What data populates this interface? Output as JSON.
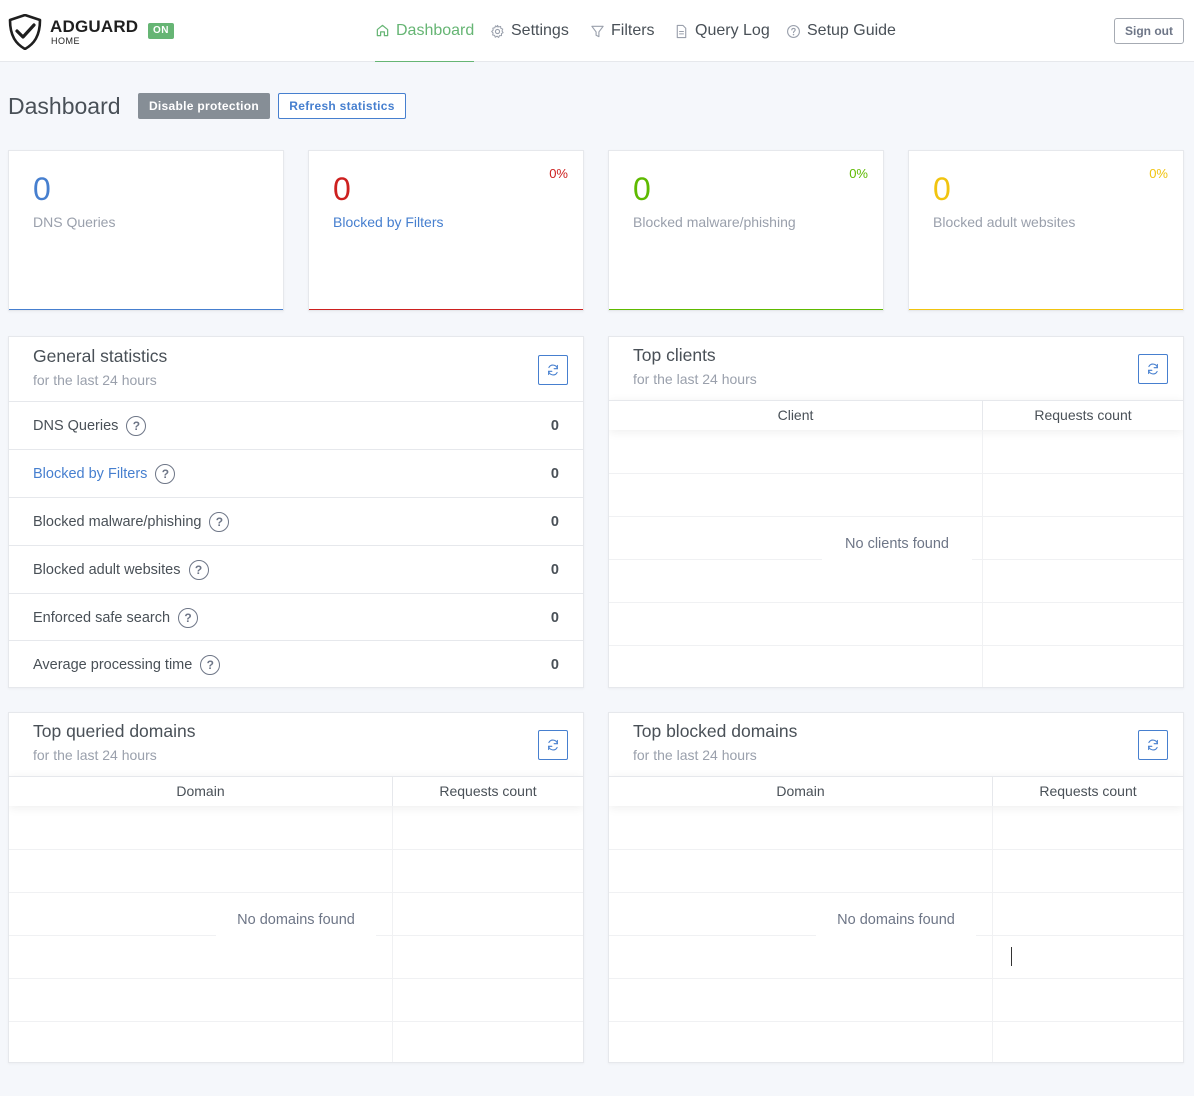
{
  "header": {
    "brand": "ADGUARD",
    "brand_sub": "HOME",
    "status_badge": "ON",
    "nav": [
      {
        "label": "Dashboard",
        "icon": "home-icon",
        "active": true
      },
      {
        "label": "Settings",
        "icon": "gear-icon",
        "active": false
      },
      {
        "label": "Filters",
        "icon": "filter-icon",
        "active": false
      },
      {
        "label": "Query Log",
        "icon": "document-icon",
        "active": false
      },
      {
        "label": "Setup Guide",
        "icon": "help-circle-icon",
        "active": false
      }
    ],
    "sign_out": "Sign out"
  },
  "page": {
    "title": "Dashboard",
    "disable_button": "Disable protection",
    "refresh_button": "Refresh statistics"
  },
  "counters": [
    {
      "value": "0",
      "label": "DNS Queries",
      "percent": "",
      "color": "#467fcf"
    },
    {
      "value": "0",
      "label": "Blocked by Filters",
      "percent": "0%",
      "color": "#cd201f"
    },
    {
      "value": "0",
      "label": "Blocked malware/phishing",
      "percent": "0%",
      "color": "#5eba00"
    },
    {
      "value": "0",
      "label": "Blocked adult websites",
      "percent": "0%",
      "color": "#f1c40f"
    }
  ],
  "general_stats": {
    "title": "General statistics",
    "subtitle": "for the last 24 hours",
    "rows": [
      {
        "label": "DNS Queries",
        "value": "0"
      },
      {
        "label": "Blocked by Filters",
        "value": "0"
      },
      {
        "label": "Blocked malware/phishing",
        "value": "0"
      },
      {
        "label": "Blocked adult websites",
        "value": "0"
      },
      {
        "label": "Enforced safe search",
        "value": "0"
      },
      {
        "label": "Average processing time",
        "value": "0"
      }
    ]
  },
  "top_clients": {
    "title": "Top clients",
    "subtitle": "for the last 24 hours",
    "col_client": "Client",
    "col_count": "Requests count",
    "empty": "No clients found"
  },
  "top_queried": {
    "title": "Top queried domains",
    "subtitle": "for the last 24 hours",
    "col_domain": "Domain",
    "col_count": "Requests count",
    "empty": "No domains found"
  },
  "top_blocked": {
    "title": "Top blocked domains",
    "subtitle": "for the last 24 hours",
    "col_domain": "Domain",
    "col_count": "Requests count",
    "empty": "No domains found"
  },
  "colors": {
    "brand_green": "#66b574",
    "primary_blue": "#467fcf",
    "red": "#cd201f",
    "green": "#5eba00",
    "yellow": "#f1c40f",
    "muted": "#9aa0ac"
  }
}
